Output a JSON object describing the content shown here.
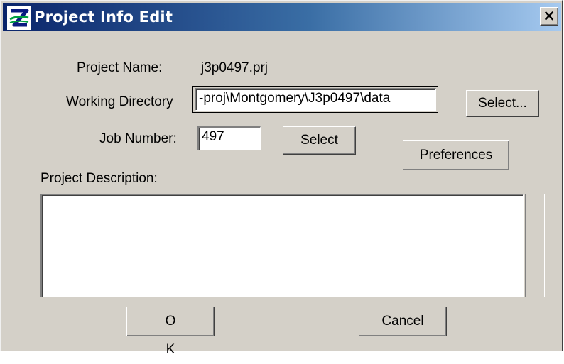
{
  "window": {
    "title": "Project Info Edit",
    "close_label": "×"
  },
  "project_name": {
    "label": "Project Name:",
    "value": "j3p0497.prj"
  },
  "working_directory": {
    "label": "Working Directory",
    "value": "-proj\\Montgomery\\J3p0497\\data",
    "select_label": "Select..."
  },
  "job_number": {
    "label": "Job Number:",
    "value": "497",
    "select_label": "Select"
  },
  "preferences_label": "Preferences",
  "project_description": {
    "label": "Project Description:",
    "value": ""
  },
  "buttons": {
    "ok_mnemonic": "O",
    "ok_rest": "K",
    "cancel_label": "Cancel"
  },
  "colors": {
    "dialog_bg": "#d4d0c8",
    "titlebar_start": "#0a246a",
    "titlebar_end": "#a6caf0"
  },
  "icons": {
    "app": "app-logo-icon",
    "close": "close-icon"
  }
}
